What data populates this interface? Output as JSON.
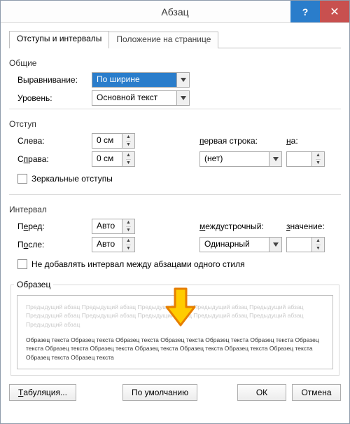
{
  "window": {
    "title": "Абзац",
    "help": "?",
    "close": "✕"
  },
  "tabs": {
    "active": "Отступы и интервалы",
    "inactive": "Положение на странице"
  },
  "general": {
    "title": "Общие",
    "alignment_label": "Выравнивание:",
    "alignment_value": "По ширине",
    "level_label": "Уровень:",
    "level_value": "Основной текст"
  },
  "indent": {
    "title": "Отступ",
    "left_label": "Слева:",
    "left_value": "0 см",
    "right_label": "Справа:",
    "right_value": "0 см",
    "firstline_label": "первая строка:",
    "firstline_value": "(нет)",
    "by_label": "на:",
    "by_value": "",
    "mirror_label": "Зеркальные отступы"
  },
  "spacing": {
    "title": "Интервал",
    "before_label": "Перед:",
    "before_value": "Авто",
    "after_label": "После:",
    "after_value": "Авто",
    "linespacing_label": "междустрочный:",
    "linespacing_value": "Одинарный",
    "at_label": "значение:",
    "at_value": "",
    "noadd_label": "Не добавлять интервал между абзацами одного стиля"
  },
  "sample": {
    "title": "Образец",
    "off": "Предыдущий абзац Предыдущий абзац Предыдущий абзац Предыдущий абзац Предыдущий абзац Предыдущий абзац Предыдущий абзац Предыдущий абзац Предыдущий абзац Предыдущий абзац Предыдущий абзац",
    "on": "Образец текста Образец текста Образец текста Образец текста Образец текста Образец текста Образец текста Образец текста Образец текста Образец текста Образец текста Образец текста Образец текста Образец текста Образец текста"
  },
  "buttons": {
    "tabs": "Табуляция...",
    "default": "По умолчанию",
    "ok": "ОК",
    "cancel": "Отмена"
  }
}
